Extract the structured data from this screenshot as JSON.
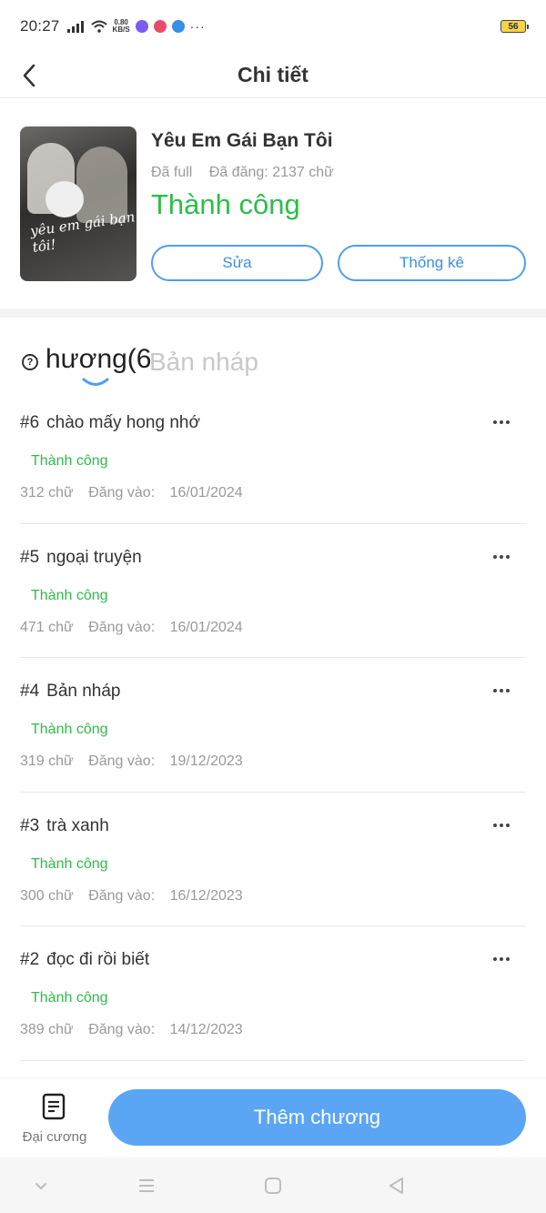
{
  "status_bar": {
    "time": "20:27",
    "speed_value": "0.80",
    "speed_unit": "KB/S",
    "battery": "56",
    "more": "···"
  },
  "header": {
    "title": "Chi tiết",
    "back_icon": "chevron-left-icon"
  },
  "book": {
    "title": "Yêu Em Gái Bạn Tôi",
    "status_full": "Đã full",
    "posted_words": "Đã đăng: 2137 chữ",
    "status": "Thành công",
    "cover_text": "yêu em gái bạn tôi!",
    "edit_label": "Sửa",
    "stats_label": "Thống kê"
  },
  "tabs": {
    "help_icon": "question-circle-icon",
    "active": "hương(6",
    "inactive": "Bản nháp"
  },
  "chapters": [
    {
      "num": "#6",
      "title": "chào mấy hong nhớ",
      "status": "Thành công",
      "words": "312 chữ",
      "posted_label": "Đăng vào:",
      "date": "16/01/2024"
    },
    {
      "num": "#5",
      "title": "ngoại truyện",
      "status": "Thành công",
      "words": "471 chữ",
      "posted_label": "Đăng vào:",
      "date": "16/01/2024"
    },
    {
      "num": "#4",
      "title": "Bản nháp",
      "status": "Thành công",
      "words": "319 chữ",
      "posted_label": "Đăng vào:",
      "date": "19/12/2023"
    },
    {
      "num": "#3",
      "title": "trà xanh",
      "status": "Thành công",
      "words": "300 chữ",
      "posted_label": "Đăng vào:",
      "date": "16/12/2023"
    },
    {
      "num": "#2",
      "title": "đọc đi rồi biết",
      "status": "Thành công",
      "words": "389 chữ",
      "posted_label": "Đăng vào:",
      "date": "14/12/2023"
    }
  ],
  "bottom": {
    "outline_label": "Đại cương",
    "outline_icon": "document-list-icon",
    "add_label": "Thêm chương"
  },
  "colors": {
    "accent_blue": "#5aa6f4",
    "success_green": "#2dbd4a",
    "muted_gray": "#999999"
  }
}
